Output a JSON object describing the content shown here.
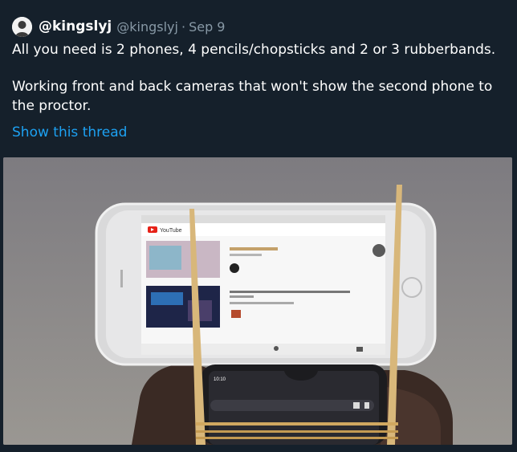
{
  "tweet": {
    "display_name": "@kingslyj",
    "handle": "@kingslyj",
    "separator": "·",
    "date": "Sep 9",
    "text_line_1": "All you need is 2 phones, 4 pencils/chopsticks and 2 or 3 rubberbands.",
    "text_line_2": "Working front and back cameras that won't show the second phone to the proctor.",
    "show_thread": "Show this thread"
  },
  "media": {
    "top_phone_logo": "YouTube",
    "bottom_phone_time": "10:10"
  },
  "colors": {
    "background": "#15202b",
    "secondary_text": "#8899a6",
    "link": "#1da1f2"
  }
}
